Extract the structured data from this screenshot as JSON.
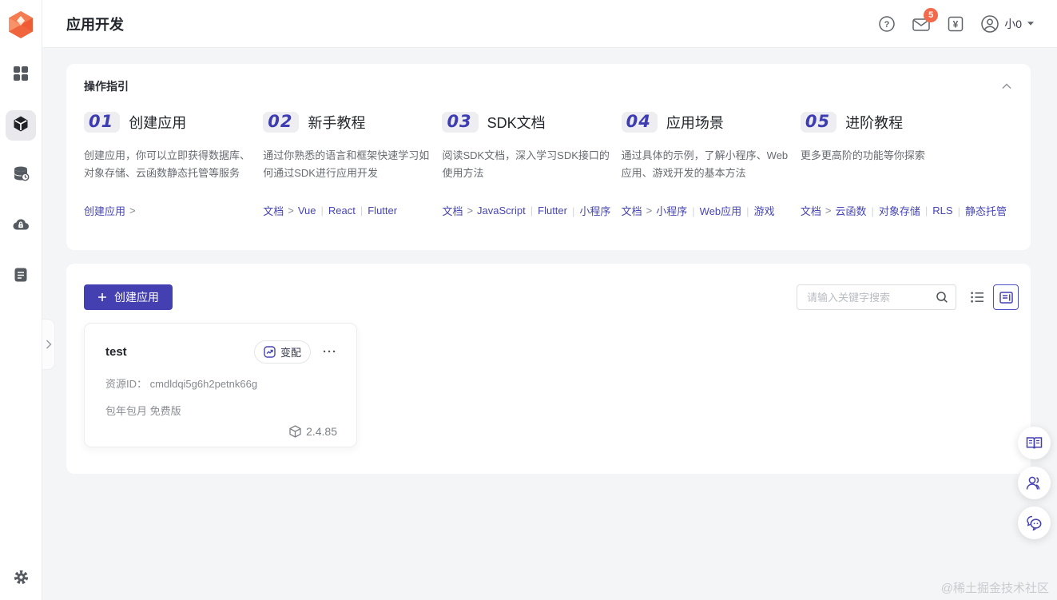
{
  "colors": {
    "accent": "#4440b2",
    "notification_badge": "#f2694c",
    "page_bg": "#f4f5f7",
    "step_number": "#3d3cb2"
  },
  "header": {
    "title": "应用开发",
    "help_glyph": "?",
    "currency_glyph": "¥",
    "notification_count": "5",
    "user_name": "小0"
  },
  "icons": {
    "logo": "cloudbase-gem",
    "sidebar": [
      "dashboard-grid",
      "app-cube",
      "database",
      "cloud-lock",
      "document",
      "settings-gear"
    ],
    "floating": [
      "book",
      "people",
      "chat-bubbles"
    ]
  },
  "guide": {
    "title": "操作指引",
    "link_arrow": ">",
    "steps": [
      {
        "num": "01",
        "title": "创建应用",
        "desc": "创建应用，你可以立即获得数据库、对象存储、云函数静态托管等服务",
        "link_label": "创建应用",
        "tags": []
      },
      {
        "num": "02",
        "title": "新手教程",
        "desc": "通过你熟悉的语言和框架快速学习如何通过SDK进行应用开发",
        "link_label": "文档",
        "tags": [
          "Vue",
          "React",
          "Flutter"
        ]
      },
      {
        "num": "03",
        "title": "SDK文档",
        "desc": "阅读SDK文档，深入学习SDK接口的使用方法",
        "link_label": "文档",
        "tags": [
          "JavaScript",
          "Flutter",
          "小程序"
        ]
      },
      {
        "num": "04",
        "title": "应用场景",
        "desc": "通过具体的示例，了解小程序、Web应用、游戏开发的基本方法",
        "link_label": "文档",
        "tags": [
          "小程序",
          "Web应用",
          "游戏"
        ]
      },
      {
        "num": "05",
        "title": "进阶教程",
        "desc": "更多更高阶的功能等你探索",
        "link_label": "文档",
        "tags": [
          "云函数",
          "对象存储",
          "RLS",
          "静态托管"
        ]
      }
    ]
  },
  "toolbar": {
    "create_button": "创建应用",
    "search_placeholder": "请输入关键字搜索"
  },
  "app_card": {
    "name": "test",
    "badge_label": "变配",
    "more_glyph": "···",
    "resource_id_label": "资源ID：",
    "resource_id": "cmdldqi5g6h2petnk66g",
    "billing": "包年包月 免费版",
    "version": "2.4.85"
  },
  "watermark": "@稀土掘金技术社区"
}
